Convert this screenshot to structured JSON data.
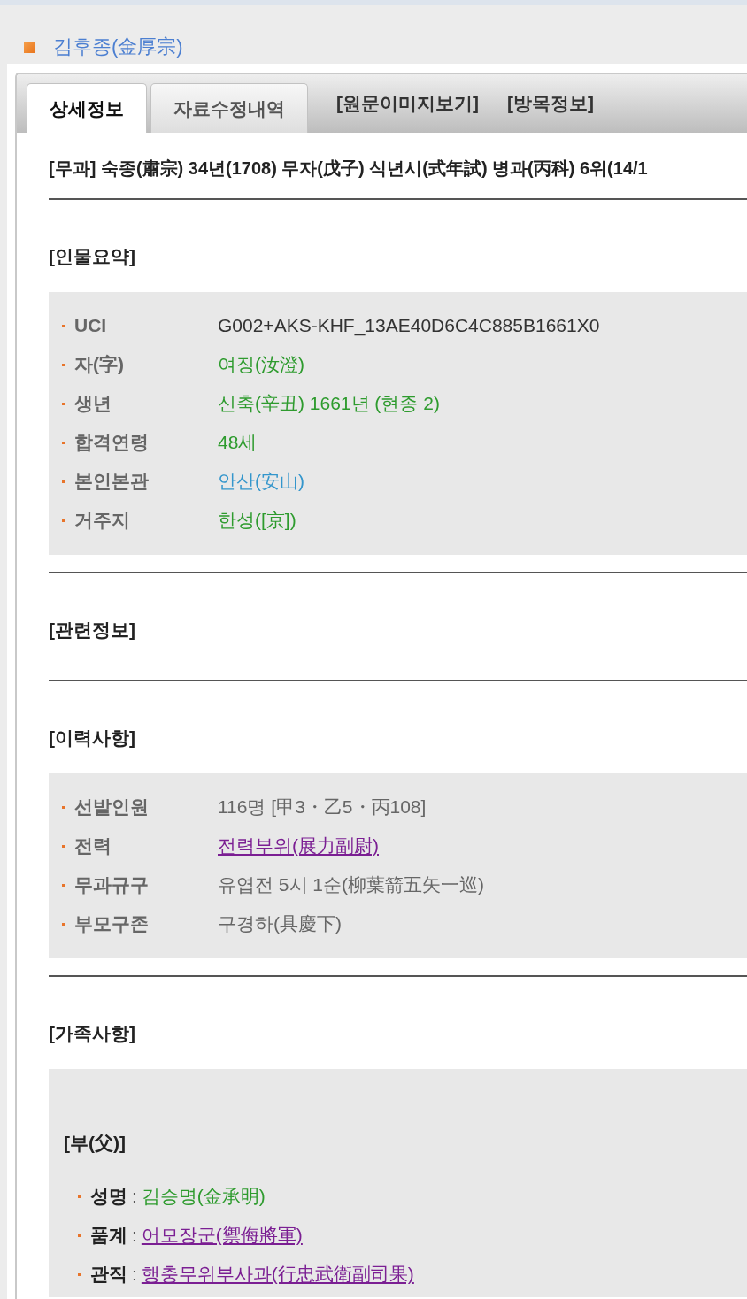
{
  "header": {
    "title": "김후종(金厚宗)"
  },
  "tabs": [
    {
      "label": "상세정보",
      "kind": "tab",
      "selected": true
    },
    {
      "label": "자료수정내역",
      "kind": "tab",
      "selected": false
    },
    {
      "label": "[원문이미지보기]",
      "kind": "link",
      "selected": false
    },
    {
      "label": "[방목정보]",
      "kind": "link",
      "selected": false
    }
  ],
  "exam_line": "[무과] 숙종(肅宗) 34년(1708) 무자(戊子) 식년시(式年試) 병과(丙科) 6위(14/1",
  "sections": [
    {
      "heading": "[인물요약]",
      "rows": [
        {
          "label": "UCI",
          "value": "G002+AKS-KHF_13AE40D6C4C885B1661X0",
          "kind": "text",
          "color": "#333333"
        },
        {
          "label": "자(字)",
          "value": "여징(汝澄)",
          "kind": "text",
          "color": "#2e9b2e"
        },
        {
          "label": "생년",
          "value": "신축(辛丑) 1661년 (현종 2)",
          "kind": "text",
          "color": "#2e9b2e"
        },
        {
          "label": "합격연령",
          "value": "48세",
          "kind": "text",
          "color": "#2e9b2e"
        },
        {
          "label": "본인본관",
          "value": "안산(安山)",
          "kind": "text",
          "color": "#3496cc"
        },
        {
          "label": "거주지",
          "value": "한성([京])",
          "kind": "text",
          "color": "#2e9b2e"
        }
      ]
    },
    {
      "heading": "[관련정보]"
    },
    {
      "heading": "[이력사항]",
      "rows": [
        {
          "label": "선발인원",
          "value": "116명 [甲3・乙5・丙108]",
          "kind": "text",
          "color": "#666666"
        },
        {
          "label": "전력",
          "value": "전력부위(展力副尉)",
          "kind": "link",
          "color": "#7b1f93"
        },
        {
          "label": "무과규구",
          "value": "유엽전 5시 1순(柳葉箭五矢一巡)",
          "kind": "text",
          "color": "#666666"
        },
        {
          "label": "부모구존",
          "value": "구경하(具慶下)",
          "kind": "text",
          "color": "#666666"
        }
      ]
    },
    {
      "heading": "[가족사항]",
      "groups": [
        {
          "relation": "[부(父)]",
          "rows": [
            {
              "label": "성명",
              "separator": ":",
              "value": "김승명(金承明)",
              "kind": "text",
              "color": "#2e9b2e"
            },
            {
              "label": "품계",
              "separator": ":",
              "value": "어모장군(禦侮將軍)",
              "kind": "link",
              "color": "#7b1f93"
            },
            {
              "label": "관직",
              "separator": ":",
              "value": "행충무위부사과(行忠武衛副司果)",
              "kind": "link",
              "color": "#7b1f93"
            }
          ]
        }
      ]
    }
  ]
}
